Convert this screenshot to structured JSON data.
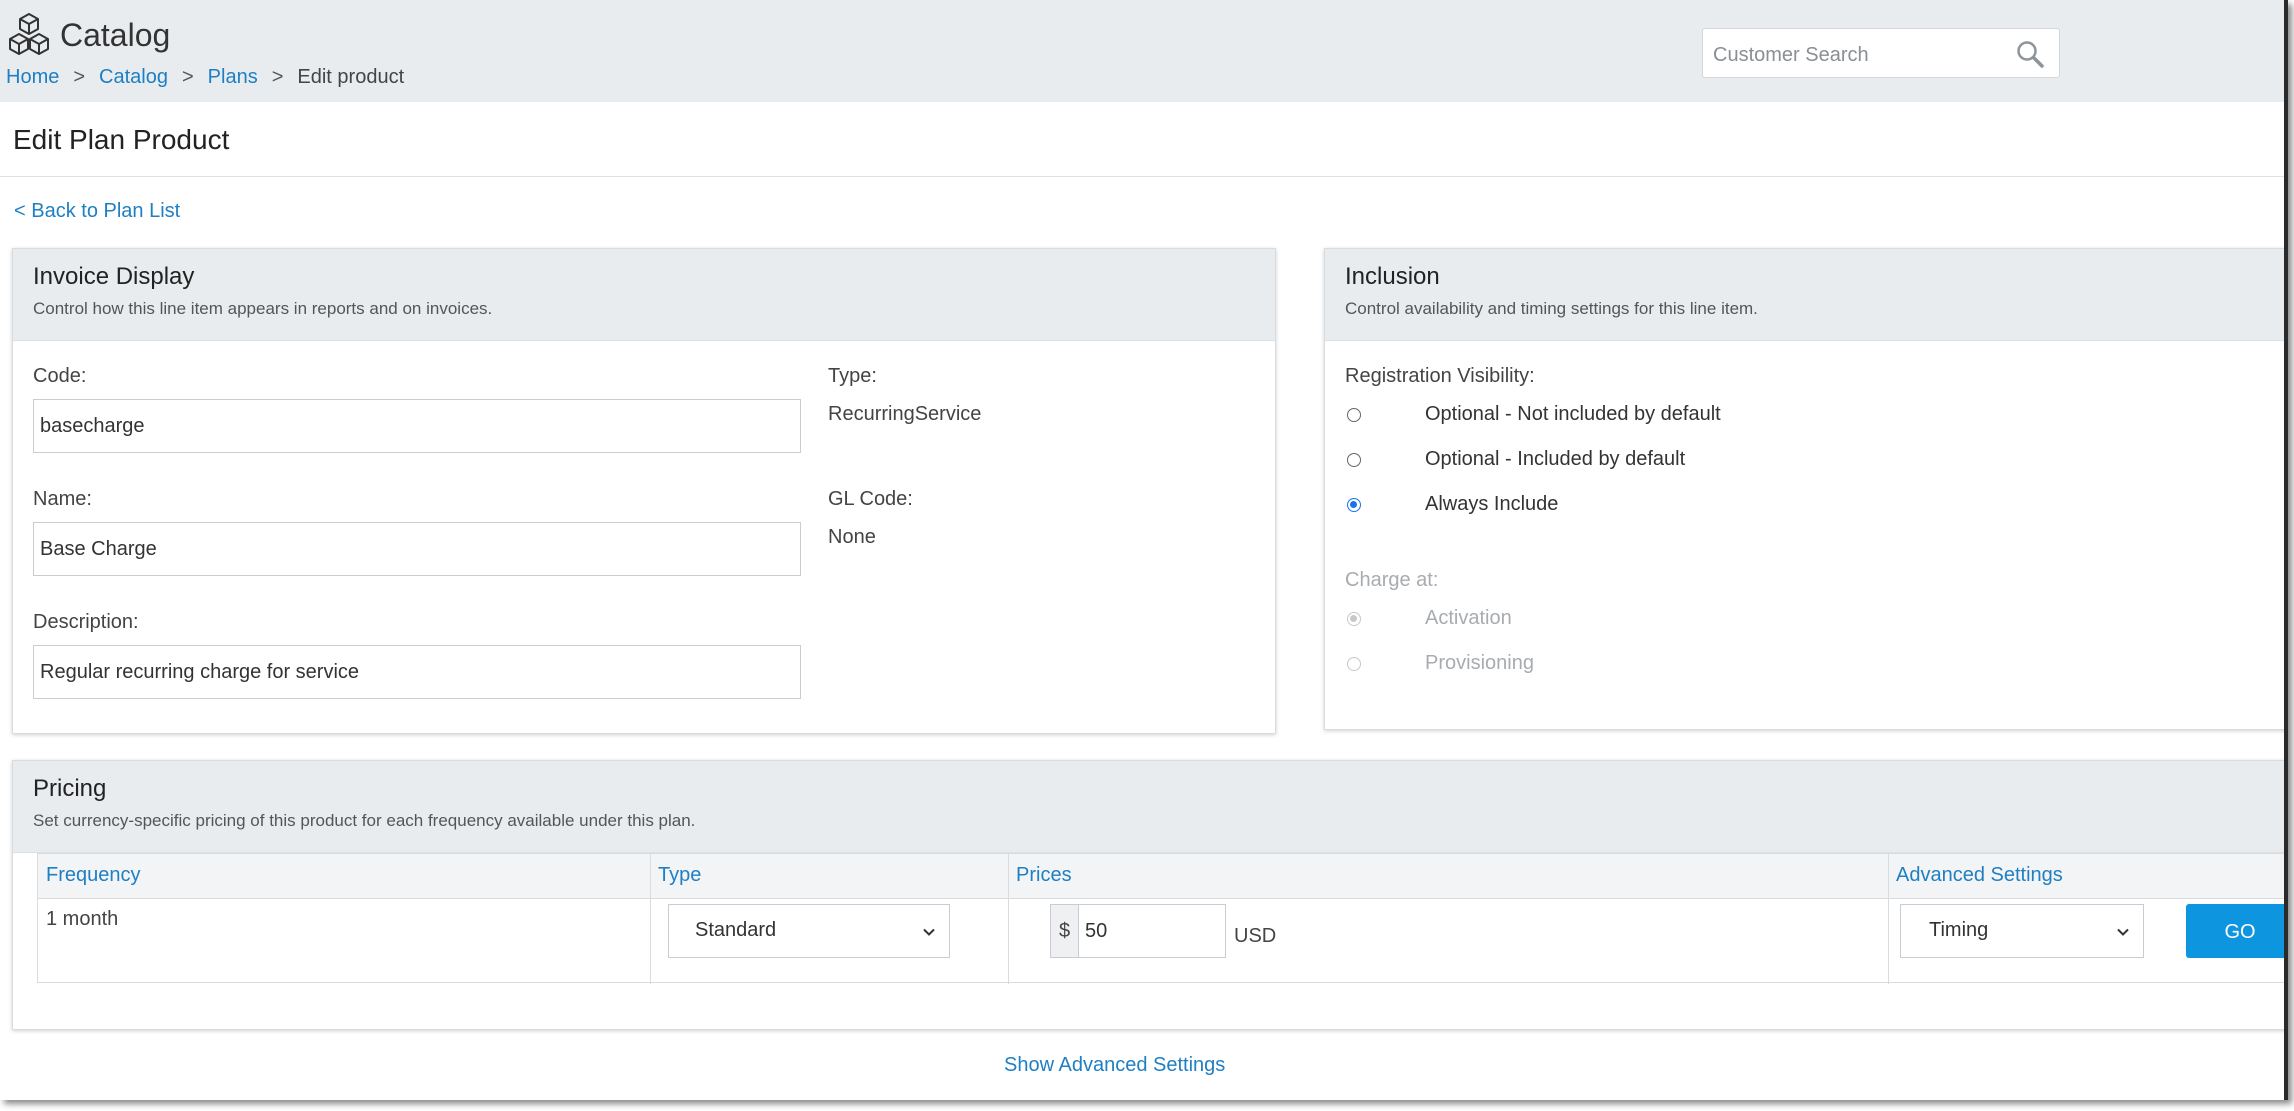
{
  "header": {
    "app_title": "Catalog",
    "breadcrumb": [
      "Home",
      "Catalog",
      "Plans",
      "Edit product"
    ],
    "breadcrumb_separator": ">",
    "search_placeholder": "Customer Search"
  },
  "page": {
    "title": "Edit Plan Product",
    "back_link": "< Back to Plan List"
  },
  "invoice_display": {
    "title": "Invoice Display",
    "subtitle": "Control how this line item appears in reports and on invoices.",
    "code_label": "Code:",
    "code_value": "basecharge",
    "name_label": "Name:",
    "name_value": "Base Charge",
    "description_label": "Description:",
    "description_value": "Regular recurring charge for service",
    "type_label": "Type:",
    "type_value": "RecurringService",
    "gl_code_label": "GL Code:",
    "gl_code_value": "None"
  },
  "inclusion": {
    "title": "Inclusion",
    "subtitle": "Control availability and timing settings for this line item.",
    "registration_label": "Registration Visibility:",
    "registration_options": [
      {
        "label": "Optional - Not included by default",
        "checked": false
      },
      {
        "label": "Optional - Included by default",
        "checked": false
      },
      {
        "label": "Always Include",
        "checked": true
      }
    ],
    "charge_label": "Charge at:",
    "charge_options": [
      {
        "label": "Activation",
        "checked": true,
        "disabled": true
      },
      {
        "label": "Provisioning",
        "checked": false,
        "disabled": true
      }
    ]
  },
  "pricing": {
    "title": "Pricing",
    "subtitle": "Set currency-specific pricing of this product for each frequency available under this plan.",
    "columns": [
      "Frequency",
      "Type",
      "Prices",
      "Advanced Settings"
    ],
    "rows": [
      {
        "frequency": "1 month",
        "type": "Standard",
        "currency_symbol": "$",
        "price": "50",
        "currency": "USD",
        "advanced_setting": "Timing",
        "go_label": "GO"
      }
    ],
    "show_advanced": "Show Advanced Settings"
  },
  "colors": {
    "link": "#1e7fc2",
    "header_bg": "#e9ecef",
    "accent_button": "#0e95e0",
    "radio_checked": "#1a73e8"
  }
}
